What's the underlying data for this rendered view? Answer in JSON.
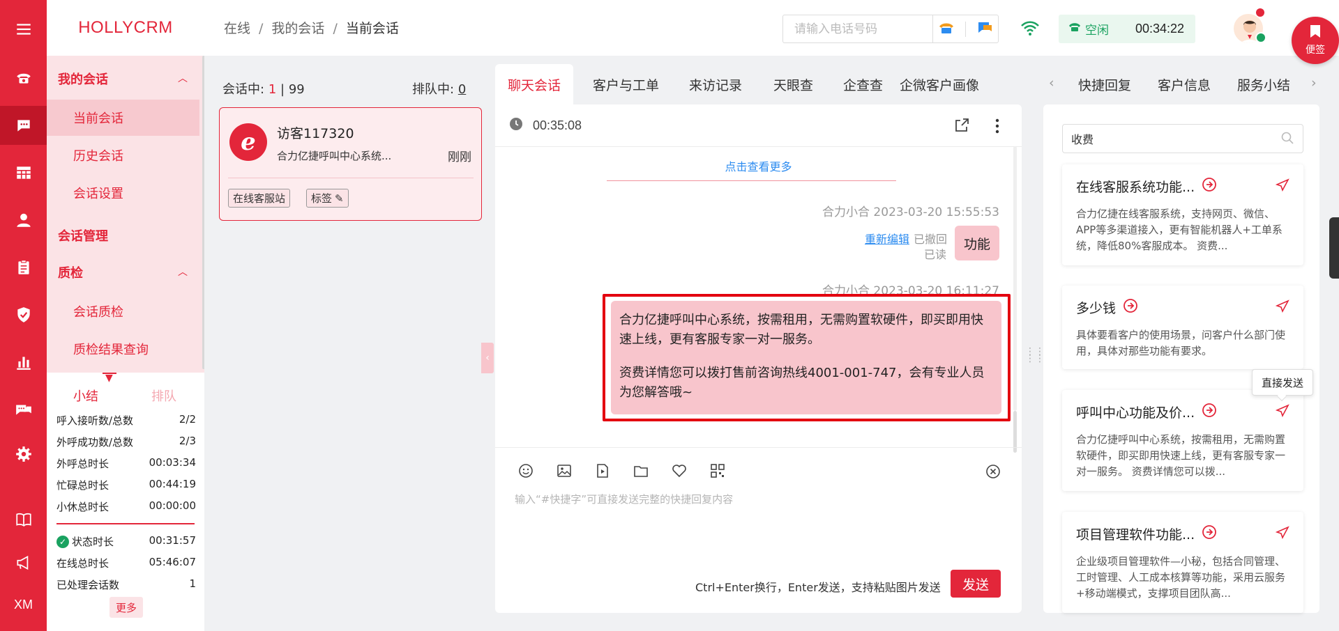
{
  "app": {
    "brand": "HOLLYCRM",
    "rail_bottom_label": "XM"
  },
  "breadcrumb": [
    "在线",
    "我的会话",
    "当前会话"
  ],
  "header": {
    "phone_placeholder": "请输入电话号码",
    "status_label": "空闲",
    "status_timer": "00:34:22",
    "sticky_label": "便签"
  },
  "left_menu": {
    "group_my_sessions": "我的会话",
    "items_sessions": [
      "当前会话",
      "历史会话",
      "会话设置"
    ],
    "group_session_manage": "会话管理",
    "group_quality": "质检",
    "items_quality": [
      "会话质检",
      "质检结果查询"
    ],
    "active_item": "当前会话"
  },
  "summary": {
    "tab_summary": "小结",
    "tab_queue": "排队",
    "stats": [
      {
        "label": "呼入接听数/总数",
        "value": "2/2"
      },
      {
        "label": "外呼成功数/总数",
        "value": "2/3"
      },
      {
        "label": "外呼总时长",
        "value": "00:03:34"
      },
      {
        "label": "忙碌总时长",
        "value": "00:44:19"
      },
      {
        "label": "小休总时长",
        "value": "00:00:00"
      }
    ],
    "stats2": [
      {
        "label": "状态时长",
        "value": "00:31:57"
      },
      {
        "label": "在线总时长",
        "value": "05:46:07"
      },
      {
        "label": "已处理会话数",
        "value": "1"
      }
    ],
    "more": "更多"
  },
  "sessions": {
    "in_session_label": "会话中:",
    "in_session_current": "1",
    "in_session_sep": "|",
    "in_session_max": "99",
    "queue_label": "排队中:",
    "queue_count": "0",
    "card": {
      "avatar_letter": "e",
      "name": "访客117320",
      "preview": "合力亿捷呼叫中心系统...",
      "time": "刚刚",
      "tag_source": "在线客服站",
      "tag_label": "标签"
    }
  },
  "chat": {
    "tabs": [
      "聊天会话",
      "客户与工单",
      "来访记录",
      "天眼查",
      "企查查",
      "企微客户画像"
    ],
    "active_tab": "聊天会话",
    "timer": "00:35:08",
    "load_more": "点击查看更多",
    "messages": [
      {
        "meta": "合力小合 2023-03-20 15:55:53",
        "text": "功能",
        "reedit": "重新编辑",
        "recalled": "已撤回",
        "read": "已读"
      },
      {
        "meta": "合力小合 2023-03-20 16:11:27",
        "para1": "合力亿捷呼叫中心系统，按需租用，无需购置软硬件，即买即用快速上线，更有客服专家一对一服务。",
        "para2": "资费详情您可以拨打售前咨询热线4001-001-747，会有专业人员为您解答哦~"
      }
    ],
    "input_placeholder": "输入“#快捷字”可直接发送完整的快捷回复内容",
    "send_hint": "Ctrl+Enter换行，Enter发送，支持粘贴图片发送",
    "send_label": "发送"
  },
  "right": {
    "tabs": [
      "快捷回复",
      "客户信息",
      "服务小结"
    ],
    "search_value": "收费",
    "tooltip": "直接发送",
    "cards": [
      {
        "title": "在线客服系统功能...",
        "body": "合力亿捷在线客服系统，支持网页、微信、APP等多渠道接入，更有智能机器人+工单系统，降低80%客服成本。 资费..."
      },
      {
        "title": "多少钱",
        "body": "具体要看客户的使用场景，问客户什么部门使用，具体对那些功能有要求。"
      },
      {
        "title": "呼叫中心功能及价...",
        "body": "合力亿捷呼叫中心系统，按需租用，无需购置软硬件，即买即用快速上线，更有客服专家一对一服务。 资费详情您可以拨..."
      },
      {
        "title": "项目管理软件功能...",
        "body": "企业级项目管理软件—小秘，包括合同管理、工时管理、人工成本核算等功能，采用云服务+移动端模式，支撑项目团队高..."
      }
    ]
  },
  "colors": {
    "brand_red": "#e3263a",
    "status_green": "#1aa260",
    "link_blue": "#2d8cf0",
    "bubble_pink": "#f8c5cc"
  }
}
